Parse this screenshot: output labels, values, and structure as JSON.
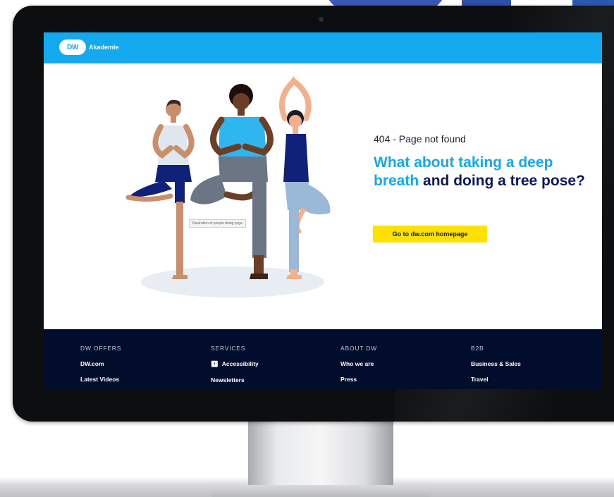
{
  "header": {
    "logo_badge": "DW",
    "logo_text": "Akademie"
  },
  "main": {
    "illustration_alt": "Illustration of people doing yoga",
    "error_code": "404 - Page not found",
    "headline_highlight": "What about taking a deep breath",
    "headline_rest": " and doing a tree pose?",
    "cta_label": "Go to dw.com homepage"
  },
  "footer": {
    "columns": [
      {
        "heading": "DW OFFERS",
        "links": [
          "DW.com",
          "Latest Videos"
        ]
      },
      {
        "heading": "SERVICES",
        "links": [
          "Accessibility",
          "Newsletters"
        ]
      },
      {
        "heading": "ABOUT DW",
        "links": [
          "Who we are",
          "Press"
        ]
      },
      {
        "heading": "B2B",
        "links": [
          "Business & Sales",
          "Travel"
        ]
      }
    ]
  },
  "colors": {
    "header_blue": "#14a9ee",
    "navy": "#0a1a5c",
    "cta_yellow": "#ffe000",
    "footer_bg": "#020c2c"
  },
  "icons": {
    "accessibility": "accessibility-icon"
  }
}
